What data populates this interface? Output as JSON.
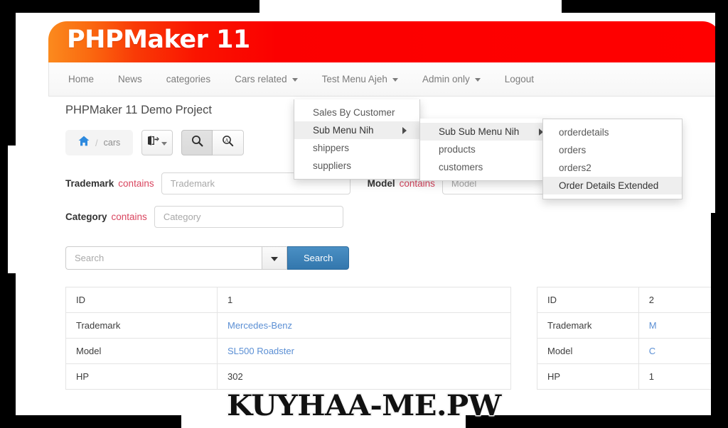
{
  "brand": {
    "title": "PHPMaker 11"
  },
  "nav": {
    "items": [
      {
        "label": "Home",
        "caret": false
      },
      {
        "label": "News",
        "caret": false
      },
      {
        "label": "categories",
        "caret": false
      },
      {
        "label": "Cars related",
        "caret": true
      },
      {
        "label": "Test Menu Ajeh",
        "caret": true
      },
      {
        "label": "Admin only",
        "caret": true
      },
      {
        "label": "Logout",
        "caret": false
      }
    ]
  },
  "menus": {
    "level1": [
      {
        "label": "Sales By Customer",
        "submenu": false,
        "highlighted": false
      },
      {
        "label": "Sub Menu Nih",
        "submenu": true,
        "highlighted": true
      },
      {
        "label": "shippers",
        "submenu": false,
        "highlighted": false
      },
      {
        "label": "suppliers",
        "submenu": false,
        "highlighted": false
      }
    ],
    "level2": [
      {
        "label": "Sub Sub Menu Nih",
        "submenu": true,
        "highlighted": true
      },
      {
        "label": "products",
        "submenu": false,
        "highlighted": false
      },
      {
        "label": "customers",
        "submenu": false,
        "highlighted": false
      }
    ],
    "level3": [
      {
        "label": "orderdetails",
        "submenu": false,
        "highlighted": false
      },
      {
        "label": "orders",
        "submenu": false,
        "highlighted": false
      },
      {
        "label": "orders2",
        "submenu": false,
        "highlighted": false
      },
      {
        "label": "Order Details Extended",
        "submenu": false,
        "highlighted": true
      }
    ]
  },
  "page": {
    "title": "PHPMaker 11 Demo Project"
  },
  "breadcrumb": {
    "home_icon": "home-icon",
    "separator": "/",
    "current": "cars"
  },
  "toolbar": {
    "export_icon": "export-share-icon",
    "search_icon": "search-icon",
    "advanced_search_icon": "advanced-search-icon"
  },
  "filters": [
    {
      "field": "Trademark",
      "operator": "contains",
      "value": "",
      "placeholder": "Trademark"
    },
    {
      "field": "Model",
      "operator": "contains",
      "value": "",
      "placeholder": "Model"
    },
    {
      "field": "Category",
      "operator": "contains",
      "value": "",
      "placeholder": "Category"
    }
  ],
  "search": {
    "value": "",
    "placeholder": "Search",
    "dropdown_icon": "chevron-down-icon",
    "button_label": "Search"
  },
  "tables": [
    {
      "rows": [
        {
          "label": "ID",
          "value": "1",
          "link": false
        },
        {
          "label": "Trademark",
          "value": "Mercedes-Benz",
          "link": true
        },
        {
          "label": "Model",
          "value": "SL500 Roadster",
          "link": true
        },
        {
          "label": "HP",
          "value": "302",
          "link": false
        }
      ]
    },
    {
      "rows": [
        {
          "label": "ID",
          "value": "2",
          "link": false
        },
        {
          "label": "Trademark",
          "value": "M",
          "link": true
        },
        {
          "label": "Model",
          "value": "C",
          "link": true
        },
        {
          "label": "HP",
          "value": "1",
          "link": false
        }
      ]
    }
  ],
  "watermark": {
    "text": "KUYHAA-ME.PW"
  },
  "colors": {
    "banner_start": "#fb8a1e",
    "banner_end": "#ff0000",
    "operator_text": "#d9455f",
    "link": "#5b8fd4",
    "primary_button": "#3377ad",
    "home_icon": "#2e8ade"
  }
}
